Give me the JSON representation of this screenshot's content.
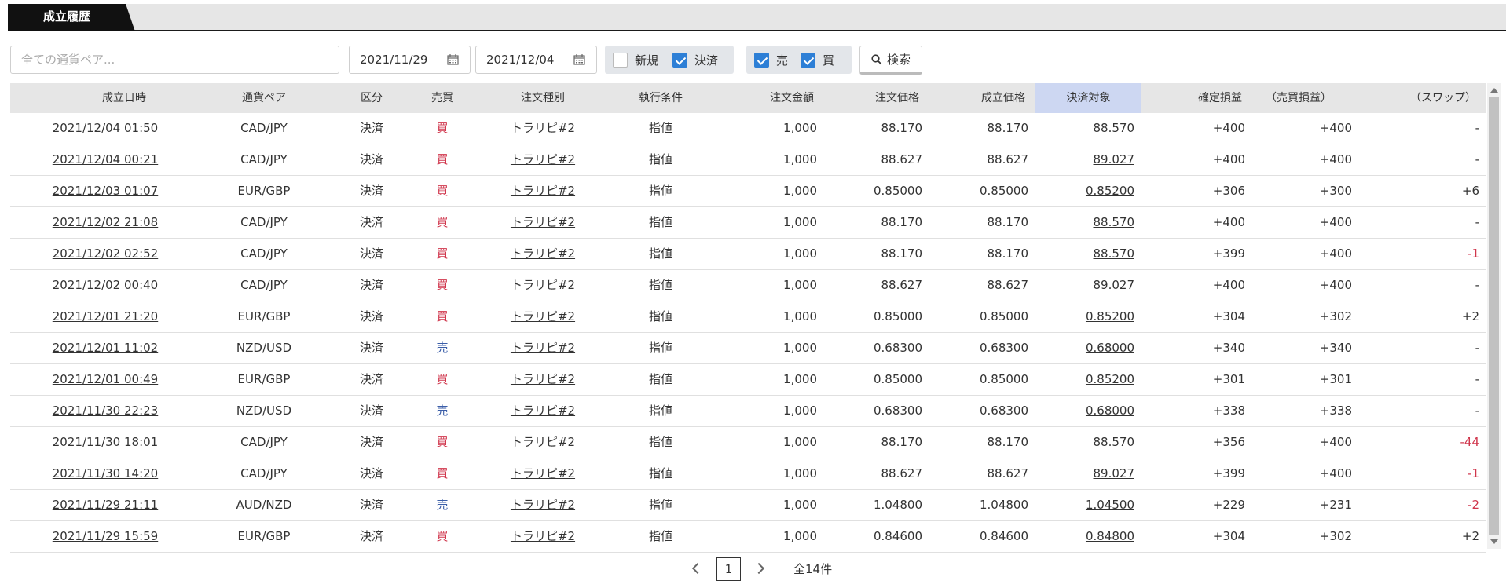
{
  "tab": {
    "label": "成立履歴"
  },
  "filters": {
    "pair_placeholder": "全ての通貨ペア...",
    "date_from": "2021/11/29",
    "date_to": "2021/12/04",
    "kubun": [
      {
        "label": "新規",
        "checked": false
      },
      {
        "label": "決済",
        "checked": true
      }
    ],
    "side": [
      {
        "label": "売",
        "checked": true
      },
      {
        "label": "買",
        "checked": true
      }
    ],
    "search_label": "検索"
  },
  "columns": [
    "成立日時",
    "通貨ペア",
    "区分",
    "売買",
    "注文種別",
    "執行条件",
    "注文金額",
    "注文価格",
    "成立価格",
    "決済対象",
    "確定損益",
    "（売買損益）",
    "（スワップ）"
  ],
  "rows": [
    [
      "2021/12/04 01:50",
      "CAD/JPY",
      "決済",
      "買",
      "トラリピ#2",
      "指値",
      "1,000",
      "88.170",
      "88.170",
      "88.570",
      "+400",
      "+400",
      "-"
    ],
    [
      "2021/12/04 00:21",
      "CAD/JPY",
      "決済",
      "買",
      "トラリピ#2",
      "指値",
      "1,000",
      "88.627",
      "88.627",
      "89.027",
      "+400",
      "+400",
      "-"
    ],
    [
      "2021/12/03 01:07",
      "EUR/GBP",
      "決済",
      "買",
      "トラリピ#2",
      "指値",
      "1,000",
      "0.85000",
      "0.85000",
      "0.85200",
      "+306",
      "+300",
      "+6"
    ],
    [
      "2021/12/02 21:08",
      "CAD/JPY",
      "決済",
      "買",
      "トラリピ#2",
      "指値",
      "1,000",
      "88.170",
      "88.170",
      "88.570",
      "+400",
      "+400",
      "-"
    ],
    [
      "2021/12/02 02:52",
      "CAD/JPY",
      "決済",
      "買",
      "トラリピ#2",
      "指値",
      "1,000",
      "88.170",
      "88.170",
      "88.570",
      "+399",
      "+400",
      "-1"
    ],
    [
      "2021/12/02 00:40",
      "CAD/JPY",
      "決済",
      "買",
      "トラリピ#2",
      "指値",
      "1,000",
      "88.627",
      "88.627",
      "89.027",
      "+400",
      "+400",
      "-"
    ],
    [
      "2021/12/01 21:20",
      "EUR/GBP",
      "決済",
      "買",
      "トラリピ#2",
      "指値",
      "1,000",
      "0.85000",
      "0.85000",
      "0.85200",
      "+304",
      "+302",
      "+2"
    ],
    [
      "2021/12/01 11:02",
      "NZD/USD",
      "決済",
      "売",
      "トラリピ#2",
      "指値",
      "1,000",
      "0.68300",
      "0.68300",
      "0.68000",
      "+340",
      "+340",
      "-"
    ],
    [
      "2021/12/01 00:49",
      "EUR/GBP",
      "決済",
      "買",
      "トラリピ#2",
      "指値",
      "1,000",
      "0.85000",
      "0.85000",
      "0.85200",
      "+301",
      "+301",
      "-"
    ],
    [
      "2021/11/30 22:23",
      "NZD/USD",
      "決済",
      "売",
      "トラリピ#2",
      "指値",
      "1,000",
      "0.68300",
      "0.68300",
      "0.68000",
      "+338",
      "+338",
      "-"
    ],
    [
      "2021/11/30 18:01",
      "CAD/JPY",
      "決済",
      "買",
      "トラリピ#2",
      "指値",
      "1,000",
      "88.170",
      "88.170",
      "88.570",
      "+356",
      "+400",
      "-44"
    ],
    [
      "2021/11/30 14:20",
      "CAD/JPY",
      "決済",
      "買",
      "トラリピ#2",
      "指値",
      "1,000",
      "88.627",
      "88.627",
      "89.027",
      "+399",
      "+400",
      "-1"
    ],
    [
      "2021/11/29 21:11",
      "AUD/NZD",
      "決済",
      "売",
      "トラリピ#2",
      "指値",
      "1,000",
      "1.04800",
      "1.04800",
      "1.04500",
      "+229",
      "+231",
      "-2"
    ],
    [
      "2021/11/29 15:59",
      "EUR/GBP",
      "決済",
      "買",
      "トラリピ#2",
      "指値",
      "1,000",
      "0.84600",
      "0.84600",
      "0.84800",
      "+304",
      "+302",
      "+2"
    ]
  ],
  "pagination": {
    "current_page": "1",
    "total": "全14件"
  },
  "colors": {
    "buy": "#d0364c",
    "sell": "#3b5ea8",
    "negative": "#d0364c",
    "header_highlight": "#cdd7f2",
    "check_on": "#2d7fd6"
  }
}
